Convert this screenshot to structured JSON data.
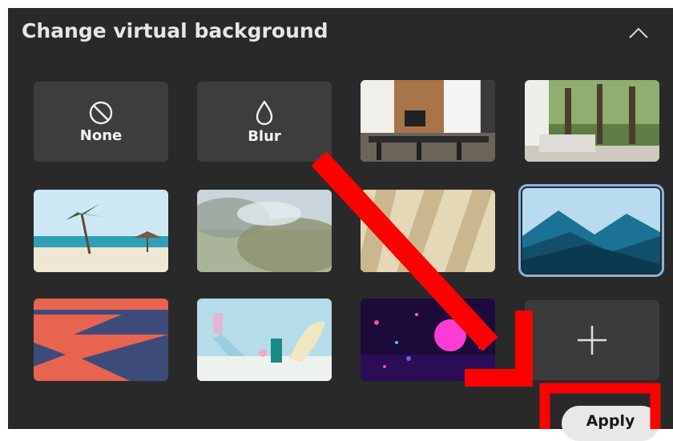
{
  "panel": {
    "title": "Change virtual background",
    "collapse_icon": "chevron-up-icon"
  },
  "options": [
    {
      "label": "None",
      "icon": "no-background-icon"
    },
    {
      "label": "Blur",
      "icon": "blur-drop-icon"
    }
  ],
  "backgrounds": [
    {
      "name": "bg-office-interior"
    },
    {
      "name": "bg-forest-lounge"
    },
    {
      "name": "bg-beach-palm"
    },
    {
      "name": "bg-blurred-landscape"
    },
    {
      "name": "bg-window-shadows"
    },
    {
      "name": "bg-blue-mountains",
      "selected": true
    },
    {
      "name": "bg-abstract-red-blue"
    },
    {
      "name": "bg-pastel-shapes"
    },
    {
      "name": "bg-neon-sphere"
    }
  ],
  "add_icon": "plus-icon",
  "apply_button": {
    "label": "Apply"
  },
  "annotation": {
    "color": "#ff0000"
  }
}
